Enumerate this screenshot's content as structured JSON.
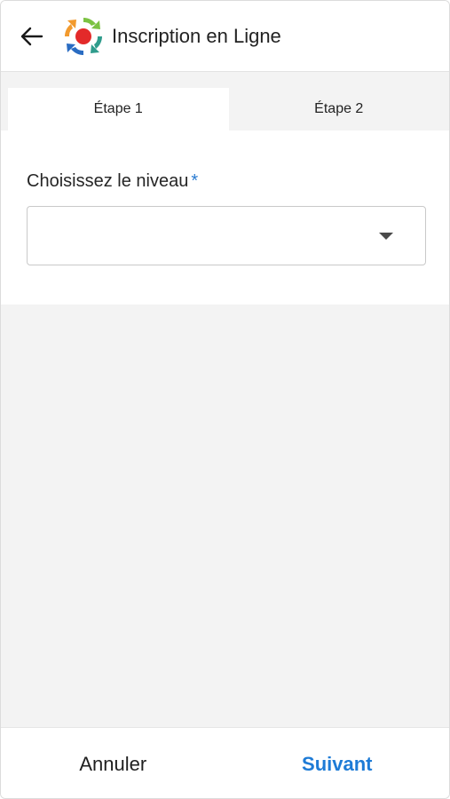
{
  "header": {
    "title": "Inscription en Ligne",
    "back_icon": "arrow-left-icon",
    "logo_icon": "app-logo-icon"
  },
  "tabs": [
    {
      "label": "Étape 1",
      "active": true
    },
    {
      "label": "Étape 2",
      "active": false
    }
  ],
  "form": {
    "level_label": "Choisissez le niveau",
    "required_marker": "*",
    "level_value": "",
    "dropdown_icon": "chevron-down-icon"
  },
  "footer": {
    "cancel_label": "Annuler",
    "next_label": "Suivant"
  },
  "colors": {
    "accent": "#1e7bd6",
    "required": "#2a7bd1",
    "background": "#f3f3f3"
  }
}
